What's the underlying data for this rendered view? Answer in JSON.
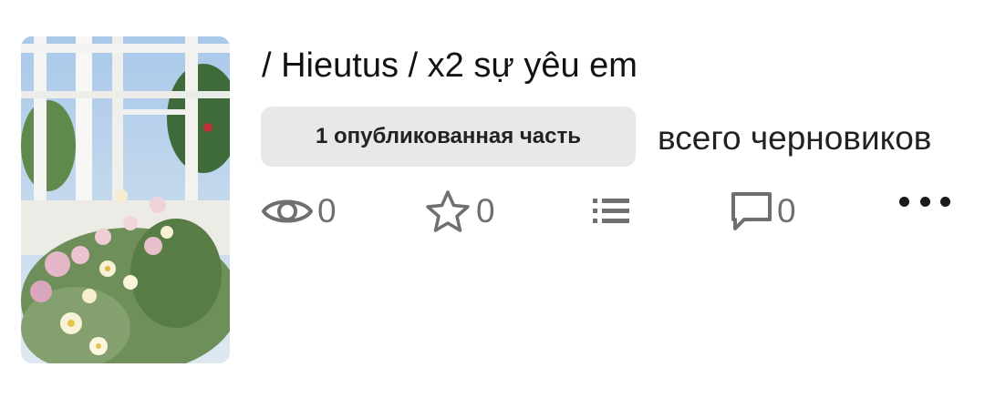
{
  "story": {
    "title": "/ Hieutus / x2 sự yêu em",
    "published_badge": "1 опубликованная часть",
    "drafts_text": "всего черновиков",
    "stats": {
      "reads": "0",
      "votes": "0",
      "comments": "0"
    }
  },
  "icons": {
    "reads": "eye-icon",
    "votes": "star-icon",
    "parts": "list-icon",
    "comments": "comment-icon",
    "more": "more-dots-icon"
  },
  "colors": {
    "badge_bg": "#e8e8e8",
    "icon_gray": "#6f6f6f"
  }
}
